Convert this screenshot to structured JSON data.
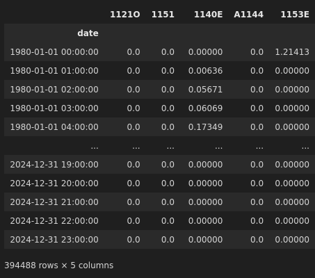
{
  "dataframe": {
    "columns": [
      "1121O",
      "1151",
      "1140E",
      "A1144",
      "1153E"
    ],
    "index_name": "date",
    "rows": [
      {
        "index": "1980-01-01 00:00:00",
        "values": [
          "0.0",
          "0.0",
          "0.00000",
          "0.0",
          "1.21413"
        ]
      },
      {
        "index": "1980-01-01 01:00:00",
        "values": [
          "0.0",
          "0.0",
          "0.00636",
          "0.0",
          "0.00000"
        ]
      },
      {
        "index": "1980-01-01 02:00:00",
        "values": [
          "0.0",
          "0.0",
          "0.05671",
          "0.0",
          "0.00000"
        ]
      },
      {
        "index": "1980-01-01 03:00:00",
        "values": [
          "0.0",
          "0.0",
          "0.06069",
          "0.0",
          "0.00000"
        ]
      },
      {
        "index": "1980-01-01 04:00:00",
        "values": [
          "0.0",
          "0.0",
          "0.17349",
          "0.0",
          "0.00000"
        ]
      },
      {
        "index": "...",
        "values": [
          "...",
          "...",
          "...",
          "...",
          "..."
        ]
      },
      {
        "index": "2024-12-31 19:00:00",
        "values": [
          "0.0",
          "0.0",
          "0.00000",
          "0.0",
          "0.00000"
        ]
      },
      {
        "index": "2024-12-31 20:00:00",
        "values": [
          "0.0",
          "0.0",
          "0.00000",
          "0.0",
          "0.00000"
        ]
      },
      {
        "index": "2024-12-31 21:00:00",
        "values": [
          "0.0",
          "0.0",
          "0.00000",
          "0.0",
          "0.00000"
        ]
      },
      {
        "index": "2024-12-31 22:00:00",
        "values": [
          "0.0",
          "0.0",
          "0.00000",
          "0.0",
          "0.00000"
        ]
      },
      {
        "index": "2024-12-31 23:00:00",
        "values": [
          "0.0",
          "0.0",
          "0.00000",
          "0.0",
          "0.00000"
        ]
      }
    ],
    "shape_text": "394488 rows × 5 columns"
  }
}
